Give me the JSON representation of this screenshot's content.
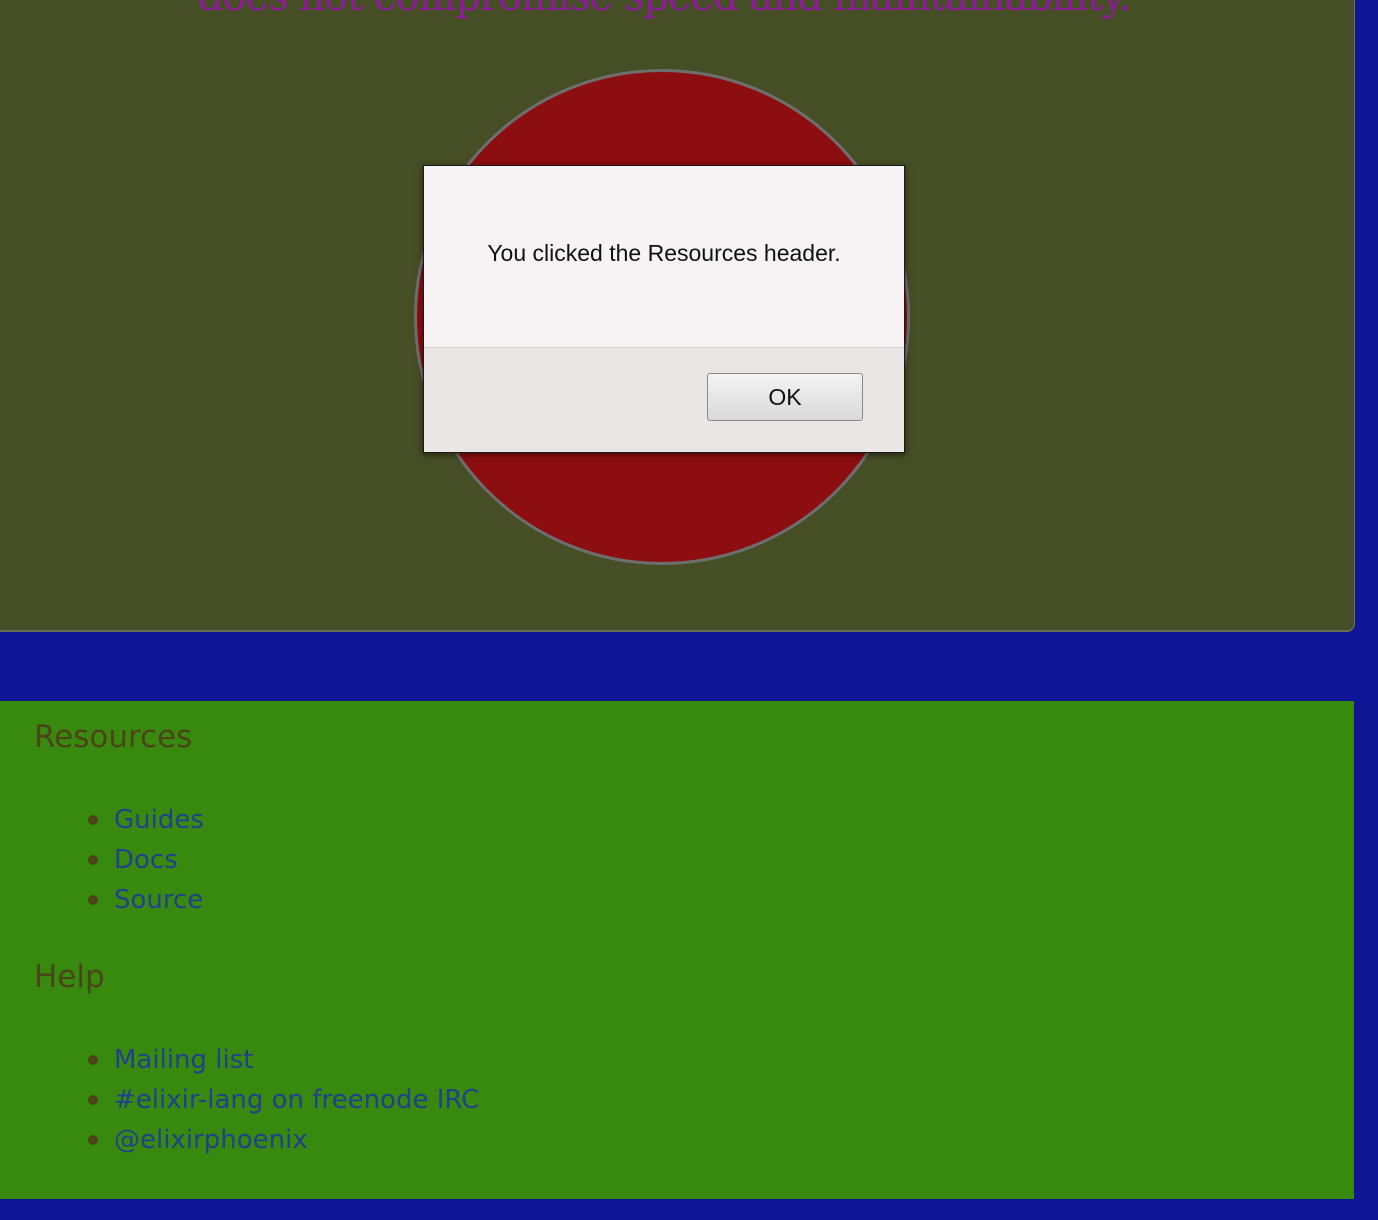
{
  "hero": {
    "tagline": "does not compromise speed and maintainability."
  },
  "resources": {
    "heading": "Resources",
    "links": [
      "Guides",
      "Docs",
      "Source"
    ]
  },
  "help": {
    "heading": "Help",
    "links": [
      "Mailing list",
      "#elixir-lang on freenode IRC",
      "@elixirphoenix"
    ]
  },
  "alert": {
    "message": "You clicked the Resources header.",
    "ok_label": "OK"
  },
  "colors": {
    "page_background": "#101595",
    "jumbotron_background": "#454e24",
    "tagline": "#8e1c9a",
    "logo_circle": "#8c0e10",
    "marketing_background": "#388a0f",
    "heading_text": "#4b4418",
    "link_text": "#21418c"
  }
}
